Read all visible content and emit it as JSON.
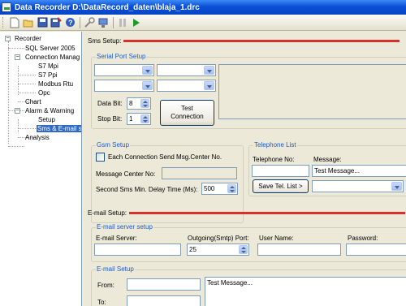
{
  "window": {
    "title": "Data Recorder D:\\DataRecord_daten\\blaja_1.drc"
  },
  "toolbar": {
    "icons": [
      "new-file-icon",
      "open-folder-icon",
      "save-icon",
      "save-as-icon",
      "help-icon",
      "tools-icon",
      "connect-icon",
      "pause-icon",
      "play-icon"
    ]
  },
  "tree": {
    "recorder": "Recorder",
    "sql": "SQL Server 2005",
    "connection": "Connection Manag",
    "s7mpi": "S7 Mpi",
    "s7ppi": "S7 Ppi",
    "modbus": "Modbus Rtu",
    "opc": "Opc",
    "chart": "Chart",
    "alarm": "Alarm & Warning",
    "setup": "Setup",
    "sms": "Sms & E-mail se",
    "analysis": "Analysis"
  },
  "sms": {
    "header": "Sms Setup:",
    "serial_group": "Serial Port Setup",
    "data_bit_label": "Data Bit:",
    "data_bit_value": "8",
    "stop_bit_label": "Stop Bit:",
    "stop_bit_value": "1",
    "test_button": "Test Connection",
    "gsm_group": "Gsm Setup",
    "each_connection_label": "Each Connection Send Msg.Center No.",
    "center_no_label": "Message Center No:",
    "delay_label": "Second Sms Min. Delay Time (Ms):",
    "delay_value": "500",
    "tel_group": "Telephone List",
    "tel_no_label": "Telephone No:",
    "message_label": "Message:",
    "message_value": "Test Message...",
    "save_tel_button": "Save Tel. List >"
  },
  "email": {
    "header": "E-mail Setup:",
    "server_group": "E-mail server setup",
    "server_label": "E-mail Server:",
    "port_label": "Outgoing(Smtp) Port:",
    "port_value": "25",
    "user_label": "User Name:",
    "password_label": "Password:",
    "setup_group": "E-mail Setup",
    "from_label": "From:",
    "to_label": "To:",
    "body_value": "Test Message..."
  },
  "colors": {
    "accent_line": "#d9302c",
    "group_label": "#1e5bc6",
    "title_bar": "#0a4fd6",
    "selection": "#316ac5"
  }
}
